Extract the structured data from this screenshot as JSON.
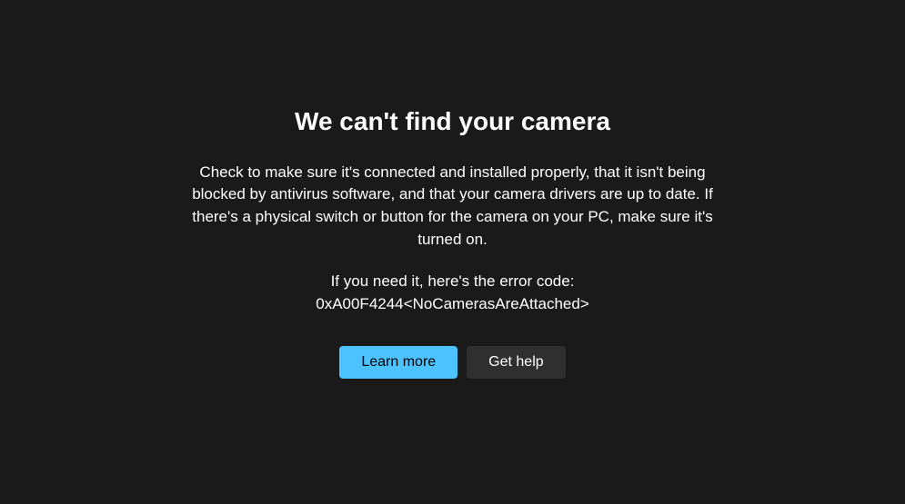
{
  "error": {
    "title": "We can't find your camera",
    "description": "Check to make sure it's connected and installed properly, that it isn't being blocked by antivirus software, and that your camera drivers are up to date. If there's a physical switch or button for the camera on your PC, make sure it's turned on.",
    "code_intro": "If you need it, here's the error code:",
    "code": "0xA00F4244<NoCamerasAreAttached>"
  },
  "buttons": {
    "learn_more": "Learn more",
    "get_help": "Get help"
  },
  "colors": {
    "background": "#1a1a1a",
    "text": "#ffffff",
    "primary_button": "#4cc2ff",
    "secondary_button": "#2f2f2f"
  }
}
